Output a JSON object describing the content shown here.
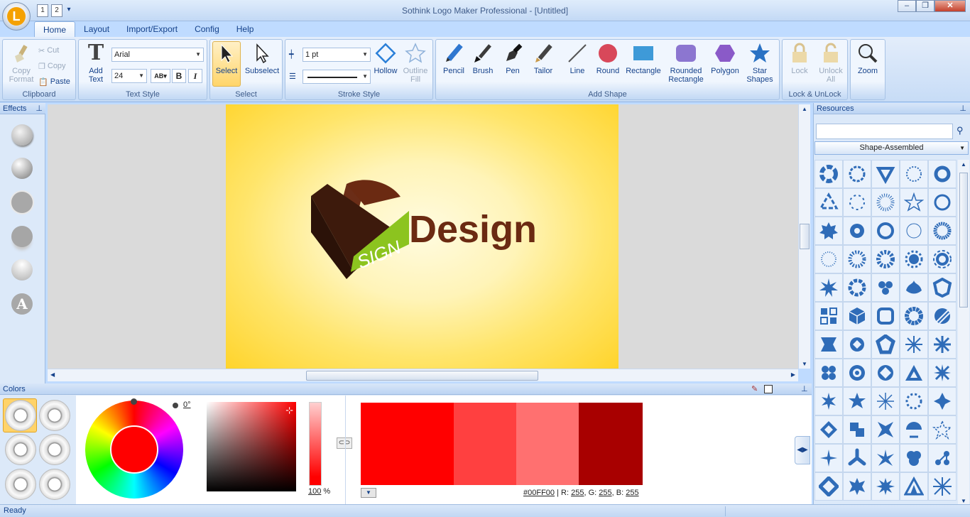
{
  "window": {
    "title": "Sothink Logo Maker Professional - [Untitled]",
    "app_initial": "L"
  },
  "qat": {
    "btn1": "1",
    "btn2": "2"
  },
  "tabs": [
    "Home",
    "Layout",
    "Import/Export",
    "Config",
    "Help"
  ],
  "clipboard": {
    "copy_format": "Copy Format",
    "cut": "Cut",
    "copy": "Copy",
    "paste": "Paste",
    "group": "Clipboard"
  },
  "text_style": {
    "add_text": "Add Text",
    "font": "Arial",
    "size": "24",
    "bold": "B",
    "italic": "I",
    "group": "Text Style"
  },
  "select": {
    "select": "Select",
    "subselect": "Subselect",
    "group": "Select"
  },
  "stroke": {
    "width": "1 pt",
    "hollow": "Hollow",
    "outline_fill": "Outline Fill",
    "group": "Stroke Style"
  },
  "add_shape": {
    "pencil": "Pencil",
    "brush": "Brush",
    "pen": "Pen",
    "tailor": "Tailor",
    "line": "Line",
    "round": "Round",
    "rectangle": "Rectangle",
    "rounded_rectangle": "Rounded Rectangle",
    "polygon": "Polygon",
    "star_shapes": "Star Shapes",
    "group": "Add Shape"
  },
  "lock": {
    "lock": "Lock",
    "unlock_all": "Unlock All",
    "group": "Lock & UnLock"
  },
  "zoom": {
    "label": "Zoom"
  },
  "effects": {
    "title": "Effects",
    "text_icon": "A"
  },
  "logo": {
    "badge_text": "SIGN",
    "word": "Design"
  },
  "resources": {
    "title": "Resources",
    "search_placeholder": "",
    "category": "Shape-Assembled"
  },
  "colors": {
    "title": "Colors",
    "angle": "0°",
    "opacity": "100",
    "opacity_unit": "%",
    "hex": "#00FF00",
    "r_label": "R:",
    "r": "255",
    "g_label": "G:",
    "g": "255",
    "b_label": "B:",
    "b": "255",
    "current_color": "#ff0000",
    "swatch_colors": [
      "#ff0000",
      "#ff4040",
      "#ff7070",
      "#a80000"
    ]
  },
  "status": {
    "text": "Ready"
  }
}
